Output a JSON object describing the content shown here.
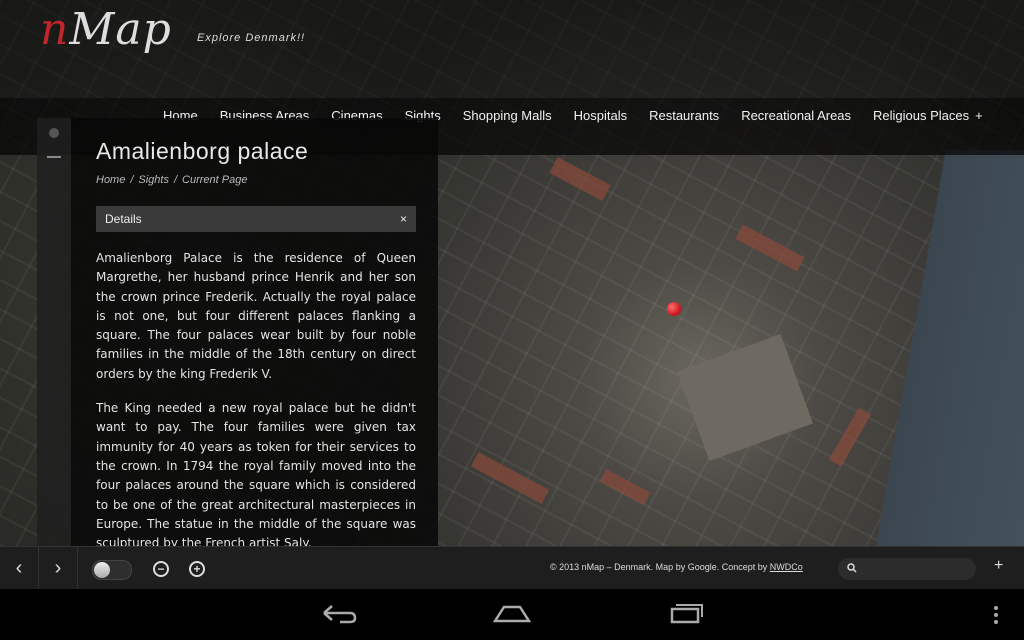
{
  "app": {
    "logo_text": "Map",
    "logo_letter": "n",
    "tagline": "Explore Denmark!!"
  },
  "nav": {
    "items": [
      "Home",
      "Business Areas",
      "Cinemas",
      "Sights",
      "Shopping Malls",
      "Hospitals",
      "Restaurants",
      "Recreational Areas",
      "Religious Places"
    ],
    "expand_symbol": "+"
  },
  "panel": {
    "title": "Amalienborg palace",
    "breadcrumb": [
      "Home",
      "Sights",
      "Current Page"
    ],
    "breadcrumb_sep": "/",
    "details_label": "Details",
    "close_symbol": "×",
    "paragraphs": [
      "Amalienborg Palace is the residence of Queen Margrethe, her husband prince Henrik and her son the crown prince Frederik. Actually the royal palace is not one, but four different palaces flanking a square. The four palaces wear built by four noble families in the middle of the 18th century on direct orders by the king Frederik V.",
      "The King needed a new royal palace but he didn't want to pay. The four families were given tax immunity for 40 years as token for their services to the crown. In 1794 the royal family moved into the four palaces around the square which is considered to be one of the great architectural masterpieces in Europe. The statue in the middle of the square was sculptured by the French artist Saly."
    ]
  },
  "footer": {
    "prev_symbol": "‹",
    "next_symbol": "›",
    "zoom_out_symbol": "−",
    "zoom_in_symbol": "+",
    "copyright": "© 2013 nMap – Denmark. Map by Google. Concept by ",
    "copyright_link": "NWDCo",
    "search_placeholder": "",
    "add_symbol": "+"
  },
  "icons": [
    "search-icon",
    "close-icon",
    "zoom-in-icon",
    "zoom-out-icon",
    "back-icon",
    "home-icon",
    "recents-icon",
    "menu-icon",
    "map-pin-icon"
  ],
  "colors": {
    "accent": "#c0262a",
    "panel_bg": "#080808",
    "footer_bg": "#1e1e1e"
  }
}
